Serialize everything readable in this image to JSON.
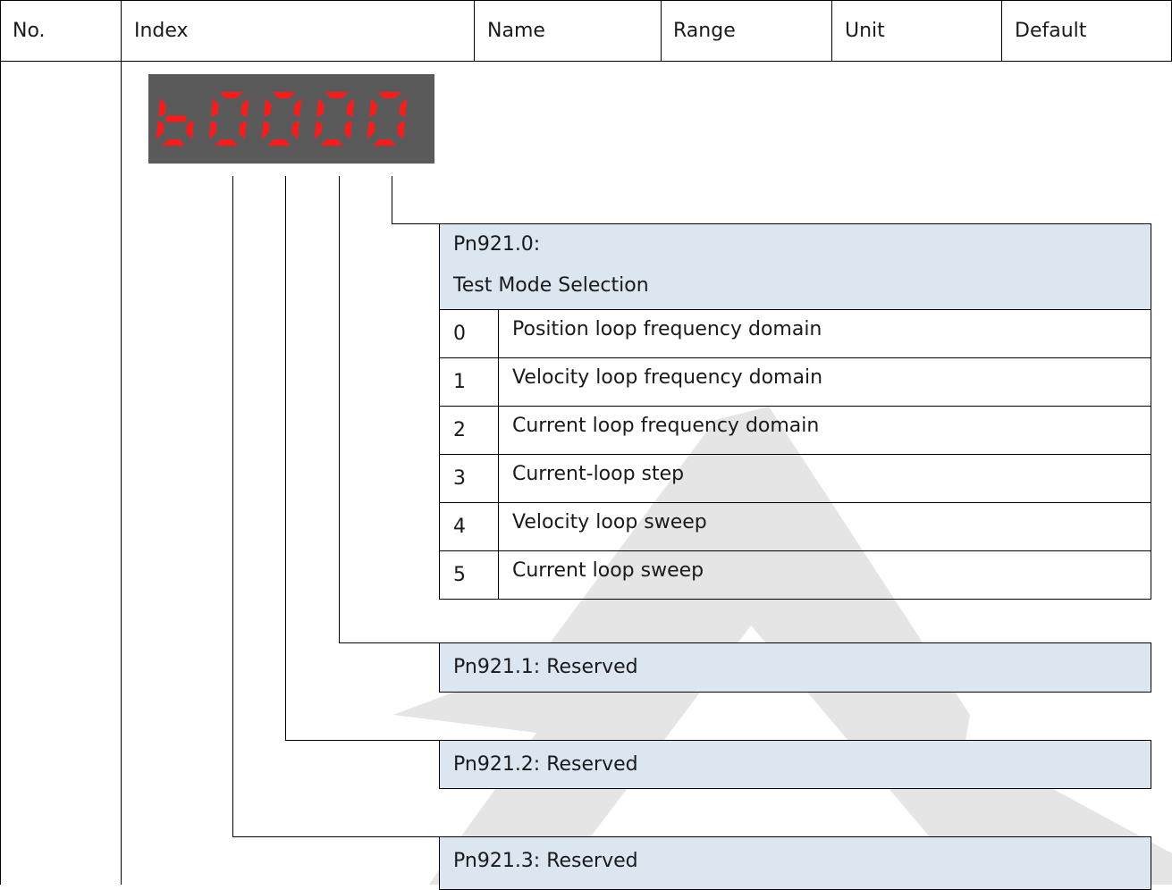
{
  "header": {
    "columns": [
      "No.",
      "Index",
      "Name",
      "Range",
      "Unit",
      "Default"
    ]
  },
  "display": {
    "digits": "b0000",
    "color": "#ff1a1a"
  },
  "parameter": {
    "digit0_code": "Pn921.0:",
    "digit0_title": "Test Mode Selection",
    "options": [
      {
        "value": "0",
        "label": "Position loop frequency domain"
      },
      {
        "value": "1",
        "label": "Velocity loop frequency domain"
      },
      {
        "value": "2",
        "label": "Current loop frequency domain"
      },
      {
        "value": "3",
        "label": "Current-loop step"
      },
      {
        "value": "4",
        "label": "Velocity loop sweep"
      },
      {
        "value": "5",
        "label": "Current loop sweep"
      }
    ],
    "digit1": "Pn921.1: Reserved",
    "digit2": "Pn921.2: Reserved",
    "digit3": "Pn921.3: Reserved"
  }
}
